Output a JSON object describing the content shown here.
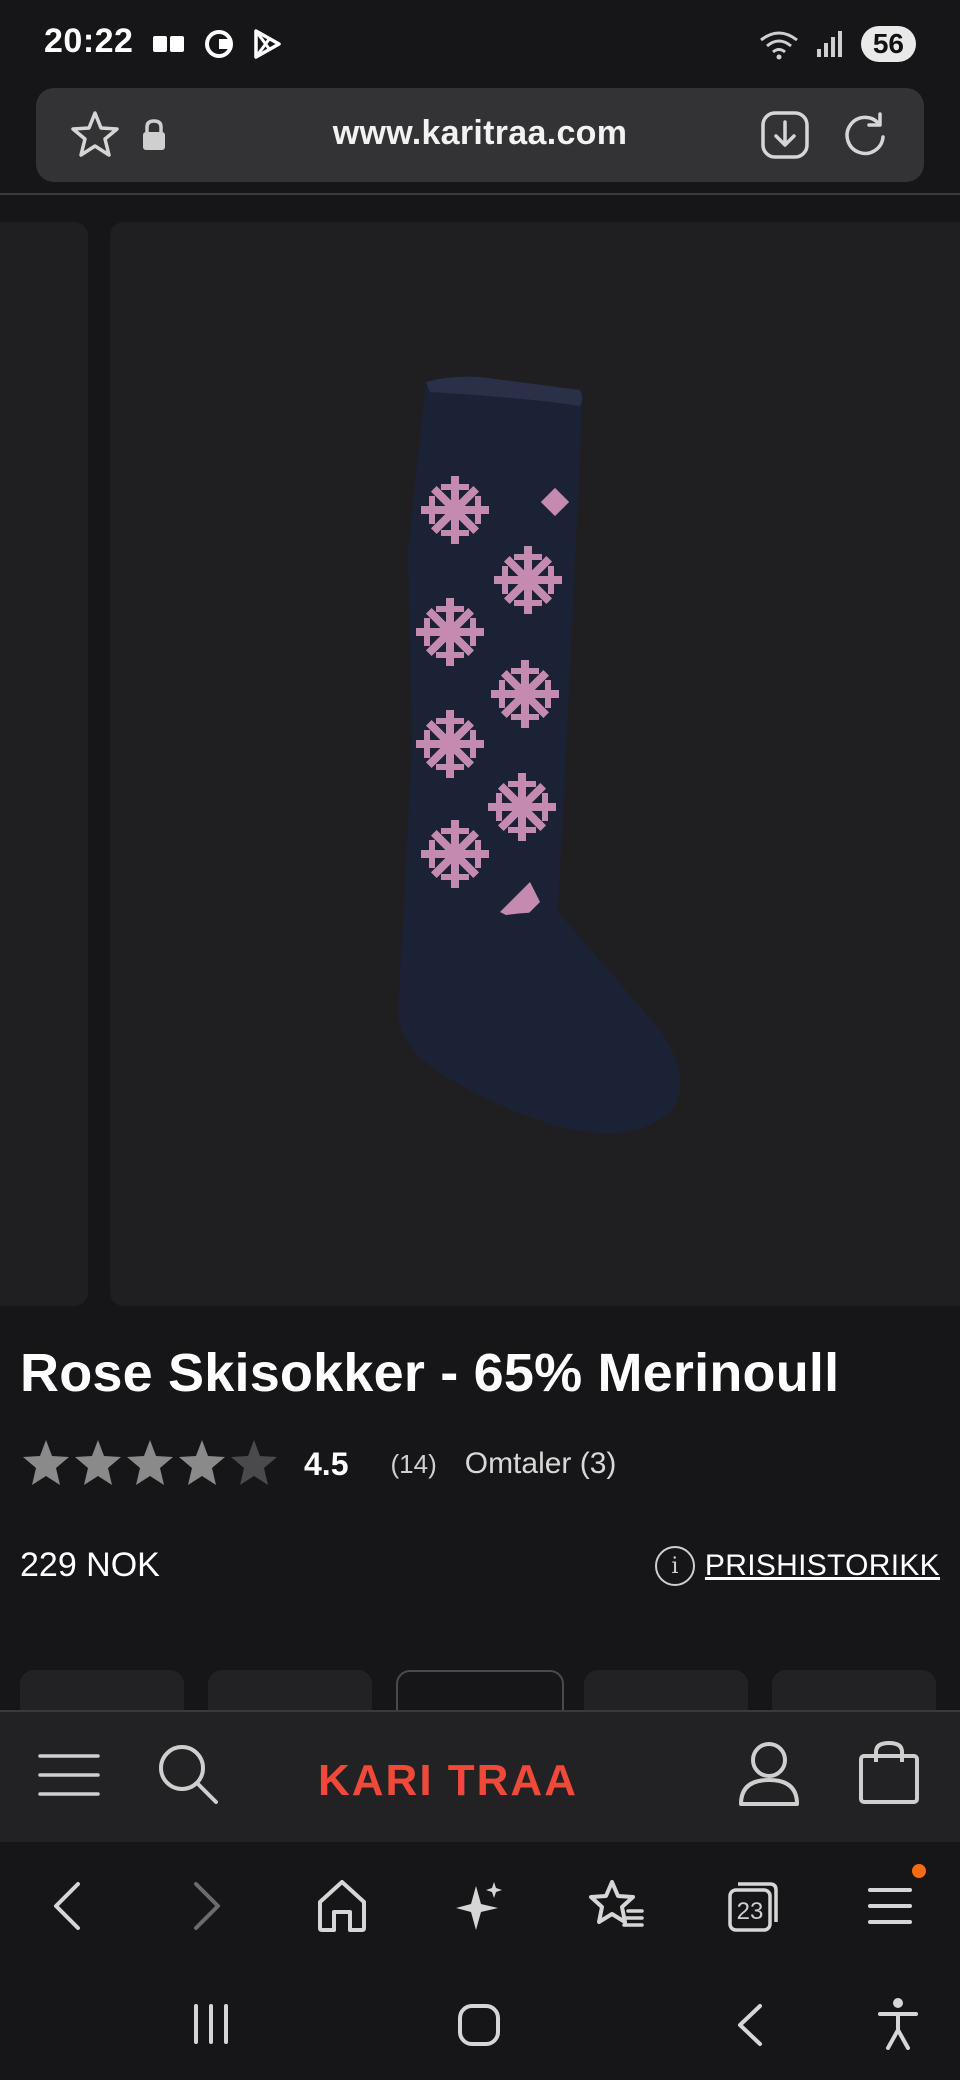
{
  "status_bar": {
    "time": "20:22",
    "battery": "56",
    "icons": [
      "notification-icon",
      "record-icon",
      "play-store-icon",
      "wifi-icon",
      "signal-icon"
    ]
  },
  "browser": {
    "url": "www.karitraa.com",
    "tab_count": "23"
  },
  "product": {
    "title": "Rose Skisokker - 65% Merinoull",
    "rating": "4.5",
    "rating_count": "(14)",
    "reviews_label": "Omtaler (3)",
    "price": "229 NOK",
    "price_history_label": "PRISHISTORIKK",
    "info_glyph": "i",
    "stars_filled": 4.5,
    "stars_total": 5
  },
  "site_nav": {
    "brand": "KARI TRAA",
    "brand_color": "#f0493a"
  },
  "colors": {
    "background": "#161618",
    "panel": "#1f1f21",
    "sock_navy": "#1c2235",
    "sock_pink": "#c58ab0",
    "notification": "#f56b14"
  }
}
